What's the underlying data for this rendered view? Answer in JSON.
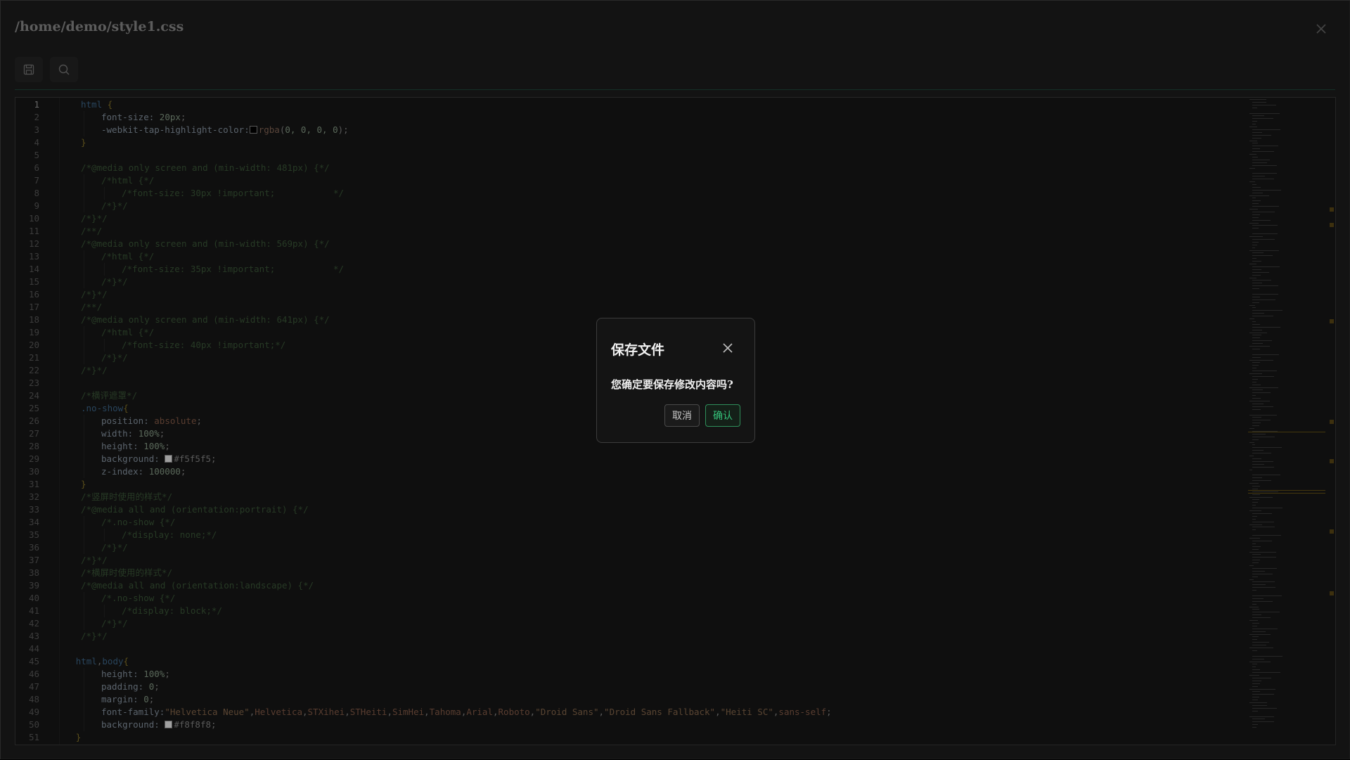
{
  "window": {
    "title": "/home/demo/style1.css"
  },
  "toolbar": {
    "buttons": [
      {
        "icon": "save-icon"
      },
      {
        "icon": "search-icon"
      }
    ]
  },
  "editor": {
    "active_line": 1,
    "lines": [
      {
        "n": "1",
        "indent": 1,
        "tokens": [
          [
            "sel",
            "html "
          ],
          [
            "brace",
            "{"
          ]
        ]
      },
      {
        "n": "2",
        "indent": 2,
        "tokens": [
          [
            "prop",
            "font-size: "
          ],
          [
            "num",
            "20px"
          ],
          [
            "plain",
            ";"
          ]
        ]
      },
      {
        "n": "3",
        "indent": 2,
        "tokens": [
          [
            "prop",
            "-webkit-tap-highlight-color:"
          ],
          [
            "swatch",
            "#000000"
          ],
          [
            "fn",
            "rgba"
          ],
          [
            "plain",
            "("
          ],
          [
            "num",
            "0, 0, 0, 0"
          ],
          [
            "plain",
            ");"
          ]
        ]
      },
      {
        "n": "4",
        "indent": 1,
        "tokens": [
          [
            "brace",
            "}"
          ]
        ]
      },
      {
        "n": "5",
        "indent": 0,
        "tokens": []
      },
      {
        "n": "6",
        "indent": 1,
        "tokens": [
          [
            "com",
            "/*@media only screen and (min-width: 481px) {*/"
          ]
        ]
      },
      {
        "n": "7",
        "indent": 2,
        "tokens": [
          [
            "com",
            "/*html {*/"
          ]
        ]
      },
      {
        "n": "8",
        "indent": 3,
        "tokens": [
          [
            "com",
            "/*font-size: 30px !important;           */"
          ]
        ]
      },
      {
        "n": "9",
        "indent": 2,
        "tokens": [
          [
            "com",
            "/*}*/"
          ]
        ]
      },
      {
        "n": "10",
        "indent": 1,
        "tokens": [
          [
            "com",
            "/*}*/"
          ]
        ]
      },
      {
        "n": "11",
        "indent": 1,
        "tokens": [
          [
            "com",
            "/**/"
          ]
        ]
      },
      {
        "n": "12",
        "indent": 1,
        "tokens": [
          [
            "com",
            "/*@media only screen and (min-width: 569px) {*/"
          ]
        ]
      },
      {
        "n": "13",
        "indent": 2,
        "tokens": [
          [
            "com",
            "/*html {*/"
          ]
        ]
      },
      {
        "n": "14",
        "indent": 3,
        "tokens": [
          [
            "com",
            "/*font-size: 35px !important;           */"
          ]
        ]
      },
      {
        "n": "15",
        "indent": 2,
        "tokens": [
          [
            "com",
            "/*}*/"
          ]
        ]
      },
      {
        "n": "16",
        "indent": 1,
        "tokens": [
          [
            "com",
            "/*}*/"
          ]
        ]
      },
      {
        "n": "17",
        "indent": 1,
        "tokens": [
          [
            "com",
            "/**/"
          ]
        ]
      },
      {
        "n": "18",
        "indent": 1,
        "tokens": [
          [
            "com",
            "/*@media only screen and (min-width: 641px) {*/"
          ]
        ]
      },
      {
        "n": "19",
        "indent": 2,
        "tokens": [
          [
            "com",
            "/*html {*/"
          ]
        ]
      },
      {
        "n": "20",
        "indent": 3,
        "tokens": [
          [
            "com",
            "/*font-size: 40px !important;*/"
          ]
        ]
      },
      {
        "n": "21",
        "indent": 2,
        "tokens": [
          [
            "com",
            "/*}*/"
          ]
        ]
      },
      {
        "n": "22",
        "indent": 1,
        "tokens": [
          [
            "com",
            "/*}*/"
          ]
        ]
      },
      {
        "n": "23",
        "indent": 0,
        "tokens": []
      },
      {
        "n": "24",
        "indent": 1,
        "tokens": [
          [
            "com",
            "/*横评遮罩*/"
          ]
        ]
      },
      {
        "n": "25",
        "indent": 1,
        "tokens": [
          [
            "sel",
            ".no-show"
          ],
          [
            "brace",
            "{"
          ]
        ]
      },
      {
        "n": "26",
        "indent": 2,
        "tokens": [
          [
            "prop",
            "position: "
          ],
          [
            "kw",
            "absolute"
          ],
          [
            "plain",
            ";"
          ]
        ]
      },
      {
        "n": "27",
        "indent": 2,
        "tokens": [
          [
            "prop",
            "width: "
          ],
          [
            "num",
            "100%"
          ],
          [
            "plain",
            ";"
          ]
        ]
      },
      {
        "n": "28",
        "indent": 2,
        "tokens": [
          [
            "prop",
            "height: "
          ],
          [
            "num",
            "100%"
          ],
          [
            "plain",
            ";"
          ]
        ]
      },
      {
        "n": "29",
        "indent": 2,
        "tokens": [
          [
            "prop",
            "background: "
          ],
          [
            "swatch",
            "#f5f5f5"
          ],
          [
            "plain",
            "#f5f5f5;"
          ]
        ]
      },
      {
        "n": "30",
        "indent": 2,
        "tokens": [
          [
            "prop",
            "z-index: "
          ],
          [
            "num",
            "100000"
          ],
          [
            "plain",
            ";"
          ]
        ]
      },
      {
        "n": "31",
        "indent": 1,
        "tokens": [
          [
            "brace",
            "}"
          ]
        ]
      },
      {
        "n": "32",
        "indent": 1,
        "tokens": [
          [
            "com",
            "/*竖屏时使用的样式*/"
          ]
        ]
      },
      {
        "n": "33",
        "indent": 1,
        "tokens": [
          [
            "com",
            "/*@media all and (orientation:portrait) {*/"
          ]
        ]
      },
      {
        "n": "34",
        "indent": 2,
        "tokens": [
          [
            "com",
            "/*.no-show {*/"
          ]
        ]
      },
      {
        "n": "35",
        "indent": 3,
        "tokens": [
          [
            "com",
            "/*display: none;*/"
          ]
        ]
      },
      {
        "n": "36",
        "indent": 2,
        "tokens": [
          [
            "com",
            "/*}*/"
          ]
        ]
      },
      {
        "n": "37",
        "indent": 1,
        "tokens": [
          [
            "com",
            "/*}*/"
          ]
        ]
      },
      {
        "n": "38",
        "indent": 1,
        "tokens": [
          [
            "com",
            "/*横屏时使用的样式*/"
          ]
        ]
      },
      {
        "n": "39",
        "indent": 1,
        "tokens": [
          [
            "com",
            "/*@media all and (orientation:landscape) {*/"
          ]
        ]
      },
      {
        "n": "40",
        "indent": 2,
        "tokens": [
          [
            "com",
            "/*.no-show {*/"
          ]
        ]
      },
      {
        "n": "41",
        "indent": 3,
        "tokens": [
          [
            "com",
            "/*display: block;*/"
          ]
        ]
      },
      {
        "n": "42",
        "indent": 2,
        "tokens": [
          [
            "com",
            "/*}*/"
          ]
        ]
      },
      {
        "n": "43",
        "indent": 1,
        "tokens": [
          [
            "com",
            "/*}*/"
          ]
        ]
      },
      {
        "n": "44",
        "indent": 0,
        "tokens": []
      },
      {
        "n": "45",
        "indent": 0.75,
        "tokens": [
          [
            "sel",
            "html"
          ],
          [
            "plain",
            ","
          ],
          [
            "sel",
            "body"
          ],
          [
            "brace",
            "{"
          ]
        ]
      },
      {
        "n": "46",
        "indent": 2,
        "tokens": [
          [
            "prop",
            "height: "
          ],
          [
            "num",
            "100%"
          ],
          [
            "plain",
            ";"
          ]
        ]
      },
      {
        "n": "47",
        "indent": 2,
        "tokens": [
          [
            "prop",
            "padding: "
          ],
          [
            "num",
            "0"
          ],
          [
            "plain",
            ";"
          ]
        ]
      },
      {
        "n": "48",
        "indent": 2,
        "tokens": [
          [
            "prop",
            "margin: "
          ],
          [
            "num",
            "0"
          ],
          [
            "plain",
            ";"
          ]
        ]
      },
      {
        "n": "49",
        "indent": 2,
        "tokens": [
          [
            "prop",
            "font-family:"
          ],
          [
            "str",
            "\"Helvetica Neue\""
          ],
          [
            "plain",
            ","
          ],
          [
            "kw",
            "Helvetica"
          ],
          [
            "plain",
            ","
          ],
          [
            "kw",
            "STXihei"
          ],
          [
            "plain",
            ","
          ],
          [
            "kw",
            "STHeiti"
          ],
          [
            "plain",
            ","
          ],
          [
            "kw",
            "SimHei"
          ],
          [
            "plain",
            ","
          ],
          [
            "kw",
            "Tahoma"
          ],
          [
            "plain",
            ","
          ],
          [
            "kw",
            "Arial"
          ],
          [
            "plain",
            ","
          ],
          [
            "kw",
            "Roboto"
          ],
          [
            "plain",
            ","
          ],
          [
            "str",
            "\"Droid Sans\""
          ],
          [
            "plain",
            ","
          ],
          [
            "str",
            "\"Droid Sans Fallback\""
          ],
          [
            "plain",
            ","
          ],
          [
            "str",
            "\"Heiti SC\""
          ],
          [
            "plain",
            ","
          ],
          [
            "kw",
            "sans-self"
          ],
          [
            "plain",
            ";"
          ]
        ]
      },
      {
        "n": "50",
        "indent": 2,
        "tokens": [
          [
            "prop",
            "background: "
          ],
          [
            "swatch",
            "#f8f8f8"
          ],
          [
            "plain",
            "#f8f8f8;"
          ]
        ]
      },
      {
        "n": "51",
        "indent": 0.75,
        "tokens": [
          [
            "brace",
            "}"
          ]
        ]
      }
    ]
  },
  "dialog": {
    "title": "保存文件",
    "message": "您确定要保存修改内容吗?",
    "cancel_label": "取消",
    "confirm_label": "确认"
  },
  "colors": {
    "accent_green": "#35c37a",
    "divider": "#1f4b3d",
    "background": "#1e1e1e"
  }
}
